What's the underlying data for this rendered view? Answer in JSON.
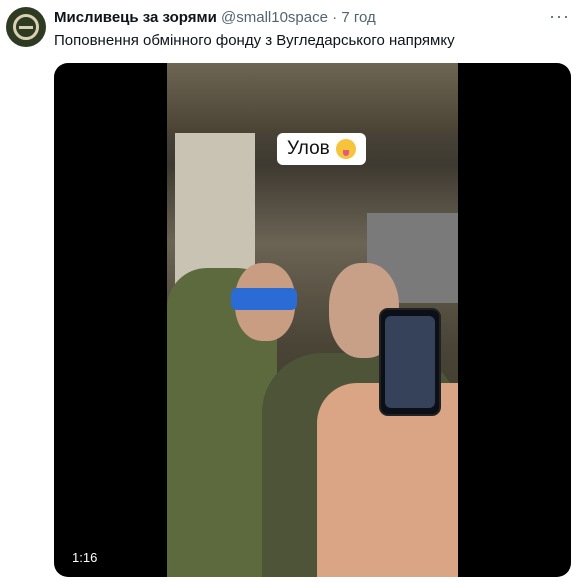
{
  "tweet": {
    "author_name": "Мисливець за зорями",
    "author_handle": "@small10space",
    "separator": "·",
    "time": "7 год",
    "text": "Поповнення обмінного фонду з Вугледарського напрямку",
    "more_icon": "more-horizontal-icon"
  },
  "video": {
    "caption": "Улов",
    "caption_emoji": "zany-face-emoji",
    "duration": "1:16"
  }
}
